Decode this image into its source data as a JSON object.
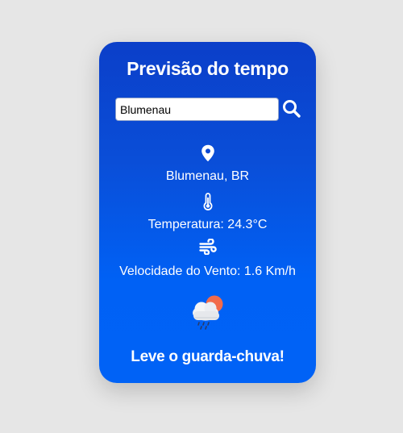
{
  "card": {
    "title": "Previsão do tempo",
    "search": {
      "value": "Blumenau",
      "button_icon": "search-icon"
    },
    "location": {
      "icon": "map-pin-icon",
      "text": "Blumenau, BR"
    },
    "temperature": {
      "icon": "thermometer-icon",
      "text": "Temperatura: 24.3°C"
    },
    "wind": {
      "icon": "wind-icon",
      "text": "Velocidade do Vento: 1.6 Km/h"
    },
    "weather_icon": "rain-cloud-sun-icon",
    "advice": "Leve o guarda-chuva!"
  },
  "colors": {
    "page_background": "#e6e6e6",
    "card_gradient_top": "#0b3fc9",
    "card_gradient_bottom": "#0062f6",
    "text": "#ffffff"
  }
}
